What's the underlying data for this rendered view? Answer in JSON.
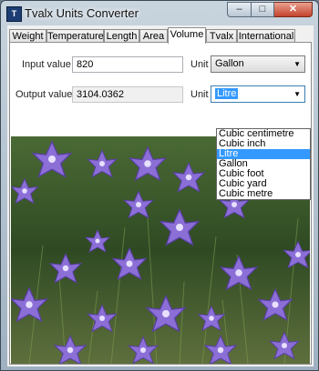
{
  "window": {
    "title": "Tvalx Units Converter",
    "minimize": "–",
    "maximize": "□",
    "close": "✕"
  },
  "tabs": [
    {
      "label": "Weight"
    },
    {
      "label": "Temperature"
    },
    {
      "label": "Length"
    },
    {
      "label": "Area"
    },
    {
      "label": "Volume",
      "active": true
    },
    {
      "label": "Tvalx"
    },
    {
      "label": "International"
    }
  ],
  "input": {
    "label": "Input value",
    "value": "820",
    "unit_label": "Unit",
    "unit_value": "Gallon"
  },
  "output": {
    "label": "Output value",
    "value": "3104.0362",
    "unit_label": "Unit",
    "unit_value": "Litre"
  },
  "unit_options": [
    "Cubic centimetre",
    "Cubic inch",
    "Litre",
    "Gallon",
    "Cubic foot",
    "Cubic yard",
    "Cubic metre"
  ],
  "highlighted_option": "Litre",
  "colors": {
    "accent": "#3399ff",
    "flower": "#8b6fd6",
    "grass": "#3f5a2a"
  }
}
